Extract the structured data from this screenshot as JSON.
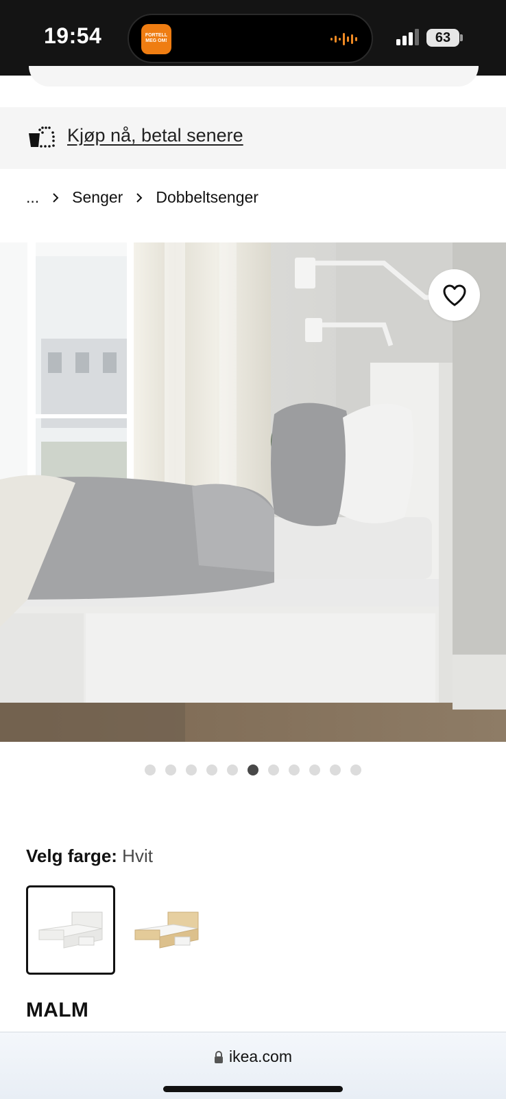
{
  "status_bar": {
    "time": "19:54",
    "island_app_text": "FORTELL MEG OM!",
    "battery": "63"
  },
  "banner": {
    "link_text": "Kjøp nå, betal senere",
    "icon": "bag-installments-icon"
  },
  "breadcrumb": [
    "...",
    "Senger",
    "Dobbeltsenger"
  ],
  "gallery": {
    "total_images": 11,
    "active_index": 5,
    "favorite_icon": "heart-icon"
  },
  "color": {
    "label": "Velg farge:",
    "value": "Hvit",
    "options": [
      "white",
      "oak-veneer"
    ]
  },
  "product": {
    "name": "MALM"
  },
  "browser": {
    "url": "ikea.com"
  },
  "colors": {
    "dot_inactive": "#dcdcdc",
    "dot_active": "#484848",
    "island_app": "#ef7d12"
  }
}
